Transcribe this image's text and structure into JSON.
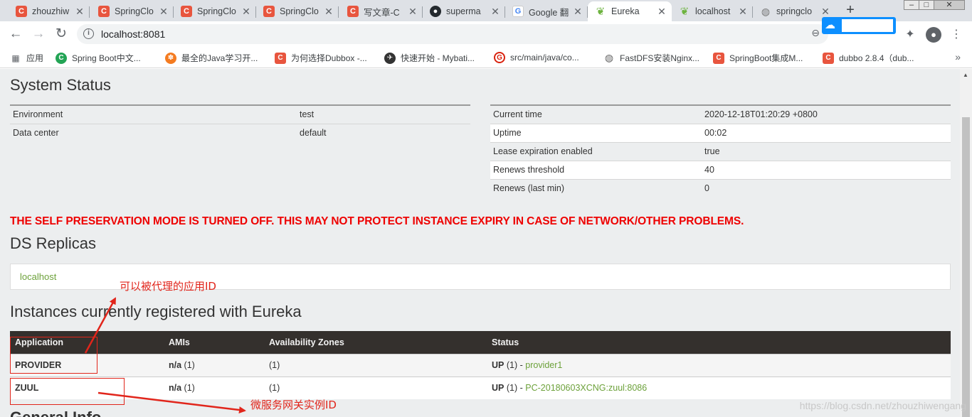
{
  "tabs": [
    {
      "title": "zhouzhiw",
      "favicon": "csdn-icon",
      "active": false
    },
    {
      "title": "SpringClo",
      "favicon": "csdn-icon",
      "active": false
    },
    {
      "title": "SpringClo",
      "favicon": "csdn-icon",
      "active": false
    },
    {
      "title": "SpringClo",
      "favicon": "csdn-icon",
      "active": false
    },
    {
      "title": "写文章-C",
      "favicon": "csdn-icon",
      "active": false
    },
    {
      "title": "superma",
      "favicon": "github-icon",
      "active": false
    },
    {
      "title": "Google 翻",
      "favicon": "google-translate-icon",
      "active": false
    },
    {
      "title": "Eureka",
      "favicon": "spring-leaf-icon",
      "active": true
    },
    {
      "title": "localhost",
      "favicon": "spring-leaf-icon",
      "active": false
    },
    {
      "title": "springclo",
      "favicon": "globe-icon",
      "active": false
    }
  ],
  "toolbar": {
    "url": "localhost:8081"
  },
  "bookmarks": {
    "apps_label": "应用",
    "items": [
      {
        "label": "Spring Boot中文...",
        "icon": "spring-icon"
      },
      {
        "label": "最全的Java学习开...",
        "icon": "orange-icon"
      },
      {
        "label": "为何选择Dubbox -...",
        "icon": "csdn-icon"
      },
      {
        "label": "快速开始 - Mybati...",
        "icon": "bird-icon"
      },
      {
        "label": "src/main/java/co...",
        "icon": "gitee-icon"
      },
      {
        "label": "FastDFS安装Nginx...",
        "icon": "globe-icon"
      },
      {
        "label": "SpringBoot集成M...",
        "icon": "csdn-icon"
      },
      {
        "label": "dubbo 2.8.4（dub...",
        "icon": "csdn-icon"
      }
    ]
  },
  "system_status": {
    "title": "System Status",
    "left": [
      {
        "key": "Environment",
        "value": "test"
      },
      {
        "key": "Data center",
        "value": "default"
      }
    ],
    "right": [
      {
        "key": "Current time",
        "value": "2020-12-18T01:20:29 +0800"
      },
      {
        "key": "Uptime",
        "value": "00:02"
      },
      {
        "key": "Lease expiration enabled",
        "value": "true"
      },
      {
        "key": "Renews threshold",
        "value": "40"
      },
      {
        "key": "Renews (last min)",
        "value": "0"
      }
    ]
  },
  "warning": "THE SELF PRESERVATION MODE IS TURNED OFF. THIS MAY NOT PROTECT INSTANCE EXPIRY IN CASE OF NETWORK/OTHER PROBLEMS.",
  "ds_replicas": {
    "title": "DS Replicas",
    "replica": "localhost"
  },
  "instances": {
    "title": "Instances currently registered with Eureka",
    "headers": [
      "Application",
      "AMIs",
      "Availability Zones",
      "Status"
    ],
    "rows": [
      {
        "app": "PROVIDER",
        "amis_bold": "n/a",
        "amis_count": "(1)",
        "zones": "(1)",
        "status_bold": "UP",
        "status_count": "(1) -",
        "instance": "provider1"
      },
      {
        "app": "ZUUL",
        "amis_bold": "n/a",
        "amis_count": "(1)",
        "zones": "(1)",
        "status_bold": "UP",
        "status_count": "(1) -",
        "instance": "PC-20180603XCNG:zuul:8086"
      }
    ]
  },
  "general_info_title": "General Info",
  "annotations": {
    "proxy_app_id": "可以被代理的应用ID",
    "gateway_instance_id": "微服务网关实例ID",
    "color": "#e1251b"
  },
  "watermark": "https://blog.csdn.net/zhouzhiwengang"
}
